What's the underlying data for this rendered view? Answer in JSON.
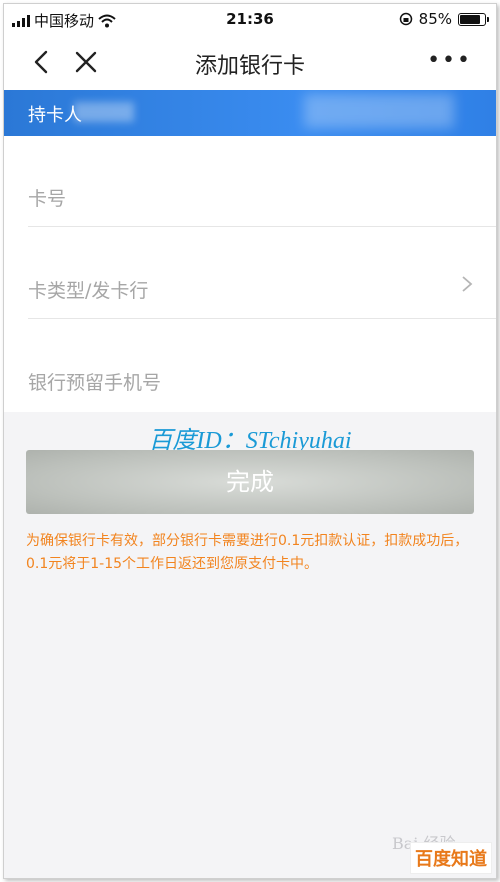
{
  "status_bar": {
    "carrier": "中国移动",
    "time": "21:36",
    "battery_percent": "85%",
    "battery_level": 0.85
  },
  "nav": {
    "title": "添加银行卡",
    "more_label": "•••"
  },
  "banner": {
    "label": "持卡人"
  },
  "form": {
    "card_number_placeholder": "卡号",
    "card_type_placeholder": "卡类型/发卡行",
    "phone_placeholder": "银行预留手机号"
  },
  "watermark": "百度ID：STchiyuhai",
  "done_button": "完成",
  "notice": "为确保银行卡有效，部分银行卡需要进行0.1元扣款认证，扣款成功后，0.1元将于1-15个工作日返还到您原支付卡中。",
  "footer": {
    "faint_logo": "Bai 经验",
    "brand_logo": "百度知道"
  },
  "colors": {
    "banner": "#3a8cf0",
    "notice": "#f2841f",
    "watermark": "#1a9ad6"
  }
}
